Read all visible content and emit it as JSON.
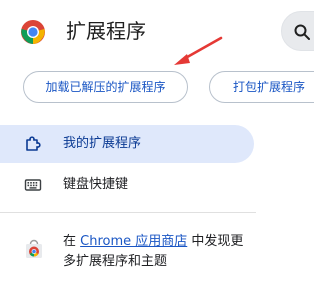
{
  "header": {
    "title": "扩展程序",
    "logo_icon": "chrome-logo-icon",
    "search_icon": "search-icon"
  },
  "actions": {
    "load_unpacked_label": "加载已解压的扩展程序",
    "pack_extension_label": "打包扩展程序"
  },
  "sidebar": {
    "items": [
      {
        "label": "我的扩展程序",
        "icon": "extension-puzzle-icon",
        "active": true
      },
      {
        "label": "键盘快捷键",
        "icon": "keyboard-icon",
        "active": false
      }
    ]
  },
  "store_promo": {
    "icon": "chrome-web-store-icon",
    "prefix": "在 ",
    "link_text": "Chrome 应用商店",
    "suffix": " 中发现更多扩展程序和主题"
  },
  "annotation": {
    "arrow_color": "#e53935"
  },
  "colors": {
    "accent": "#1a56c4",
    "active_nav_bg": "#dfe8fb"
  }
}
